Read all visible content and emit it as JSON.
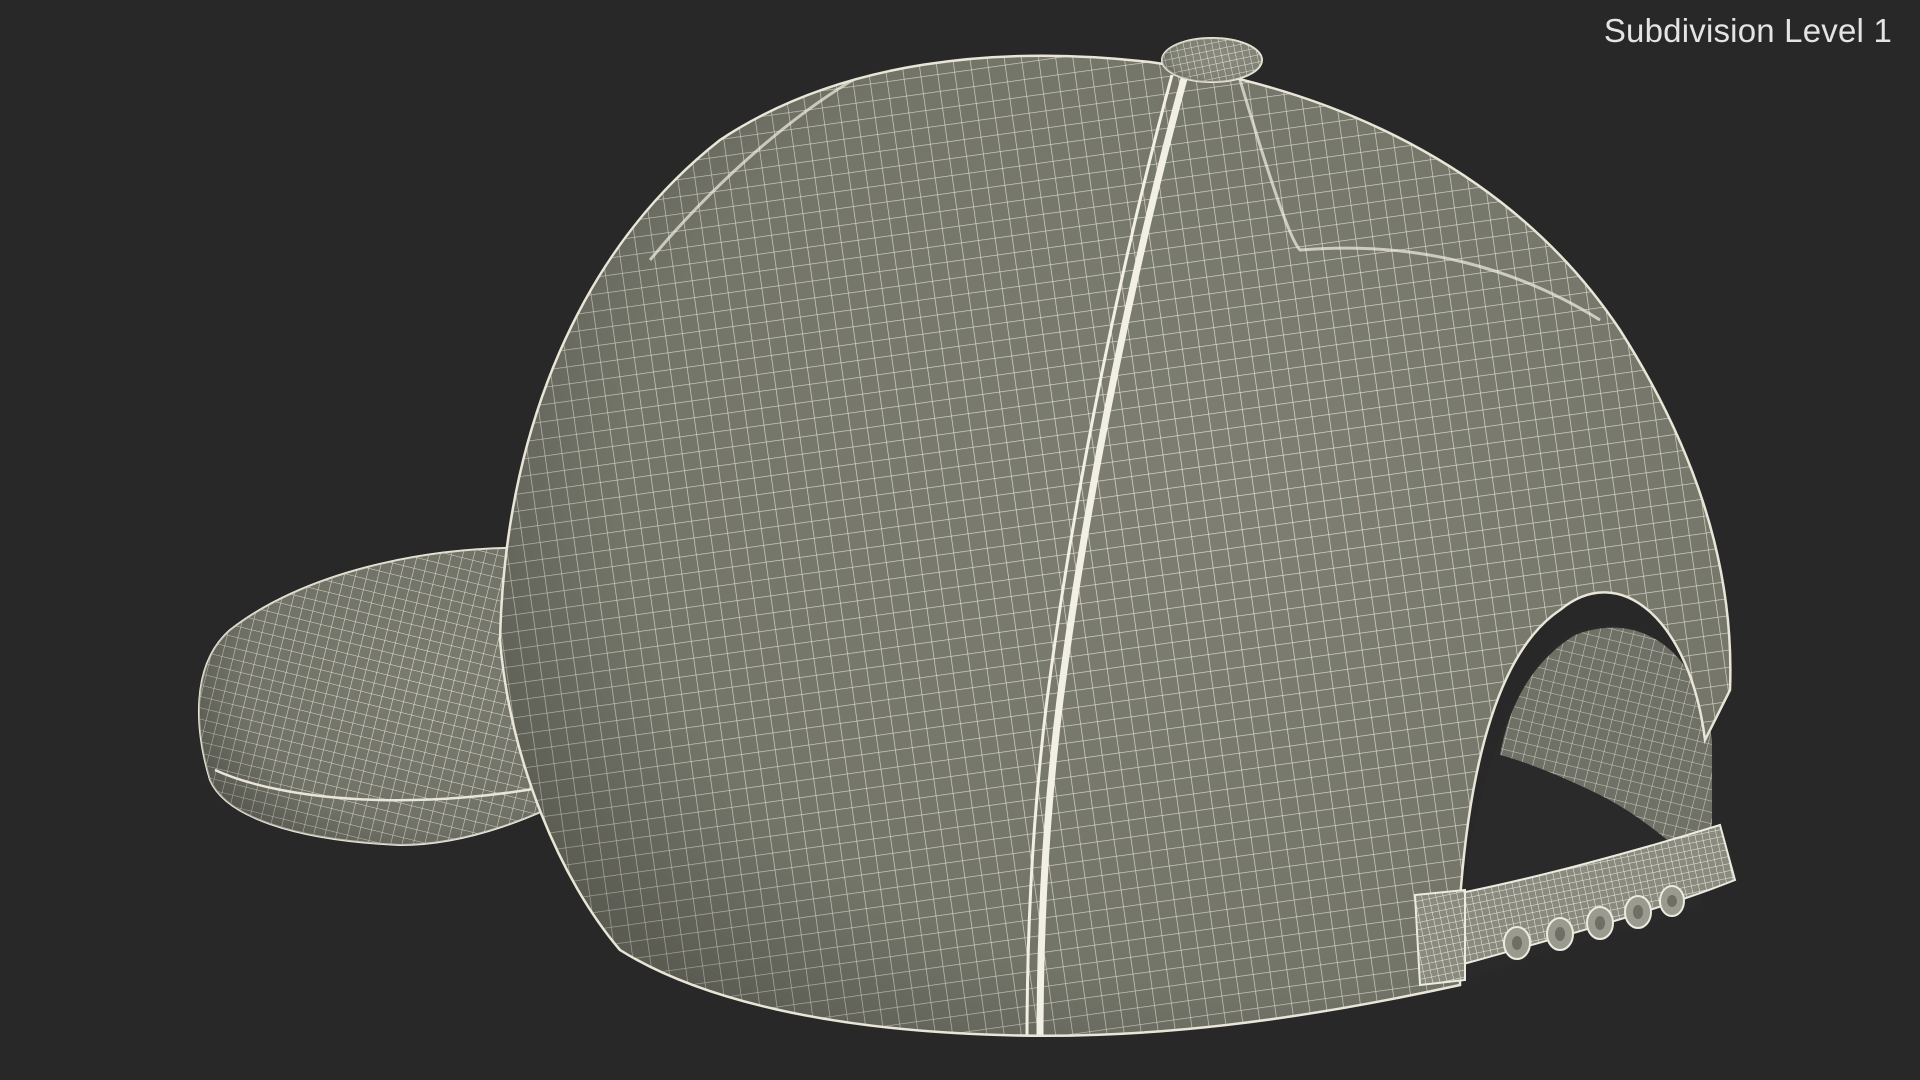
{
  "viewport": {
    "label": "Subdivision Level 1",
    "background_color": "#282828"
  },
  "model": {
    "subject": "baseball cap wireframe render",
    "surface_color": "#7e7f72",
    "wire_color": "#e9e6d8",
    "shadow_color": "#6c6d61"
  }
}
